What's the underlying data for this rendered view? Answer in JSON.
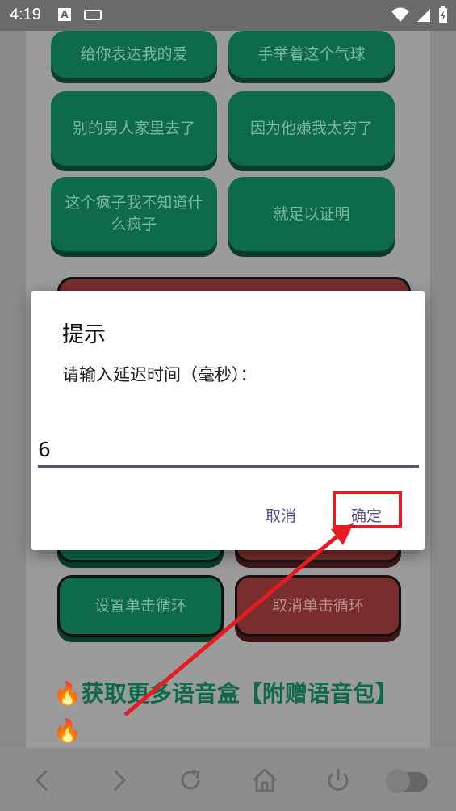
{
  "status_bar": {
    "time": "4:19",
    "a_icon": "A"
  },
  "grid_buttons": [
    {
      "label": "给你表达我的爱"
    },
    {
      "label": "手举着这个气球"
    },
    {
      "label": "别的男人家里去了"
    },
    {
      "label": "因为他嫌我太穷了"
    },
    {
      "label": "这个疯子我不知道什么疯子"
    },
    {
      "label": "就足以证明"
    }
  ],
  "loop_buttons": {
    "set_label": "设置单击循环",
    "cancel_label": "取消单击循环"
  },
  "promo": {
    "text": "获取更多语音盒【附赠语音包】"
  },
  "dialog": {
    "title": "提示",
    "message": "请输入延迟时间（毫秒）：",
    "input_value": "6",
    "cancel_label": "取消",
    "ok_label": "确定"
  },
  "colors": {
    "green": "#0e6b4a",
    "red": "#7a2d2d",
    "highlight": "#e51c23"
  }
}
